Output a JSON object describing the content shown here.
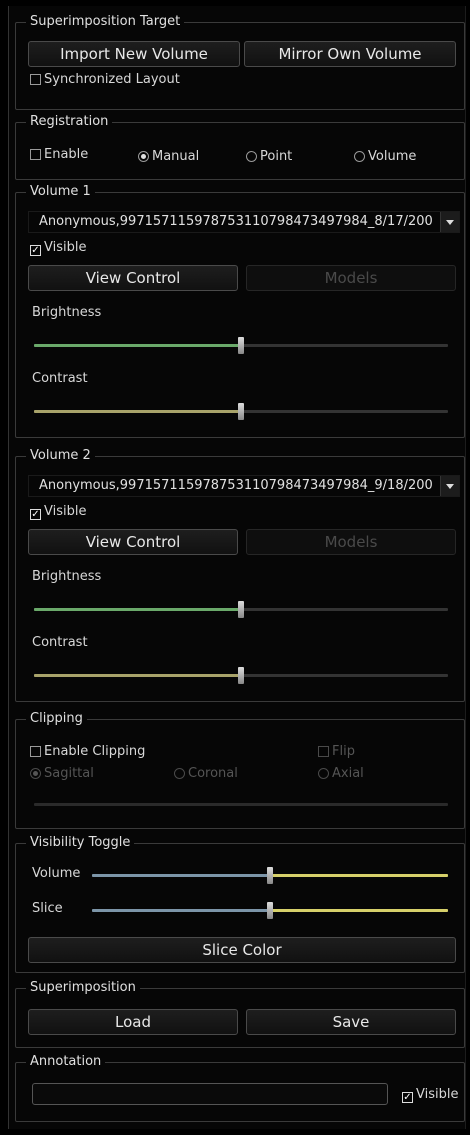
{
  "superimposition_target": {
    "title": "Superimposition Target",
    "import_label": "Import New Volume",
    "mirror_label": "Mirror Own Volume",
    "sync_label": "Synchronized Layout"
  },
  "registration": {
    "title": "Registration",
    "enable_label": "Enable",
    "manual_label": "Manual",
    "point_label": "Point",
    "volume_label": "Volume",
    "selected": "Manual"
  },
  "volume1": {
    "title": "Volume 1",
    "dataset": "Anonymous,9971571159787531107984734979​84_8/17/200",
    "visible_label": "Visible",
    "view_control_label": "View Control",
    "models_label": "Models",
    "brightness_label": "Brightness",
    "contrast_label": "Contrast",
    "brightness_value": 0.5,
    "contrast_value": 0.5
  },
  "volume2": {
    "title": "Volume 2",
    "dataset": "Anonymous,9971571159787531107984734979​84_9/18/200",
    "visible_label": "Visible",
    "view_control_label": "View Control",
    "models_label": "Models",
    "brightness_label": "Brightness",
    "contrast_label": "Contrast",
    "brightness_value": 0.5,
    "contrast_value": 0.5
  },
  "clipping": {
    "title": "Clipping",
    "enable_label": "Enable Clipping",
    "flip_label": "Flip",
    "sagittal_label": "Sagittal",
    "coronal_label": "Coronal",
    "axial_label": "Axial",
    "selected": "Sagittal"
  },
  "visibility_toggle": {
    "title": "Visibility Toggle",
    "volume_label": "Volume",
    "slice_label": "Slice",
    "volume_value": 0.5,
    "slice_value": 0.5,
    "slice_color_label": "Slice Color"
  },
  "superimposition": {
    "title": "Superimposition",
    "load_label": "Load",
    "save_label": "Save"
  },
  "annotation": {
    "title": "Annotation",
    "text_value": "",
    "visible_label": "Visible"
  },
  "colors": {
    "brightness": "#6aa96a",
    "contrast": "#a8a36a",
    "blue": "#7c95a8",
    "yellow": "#d6d06a"
  }
}
